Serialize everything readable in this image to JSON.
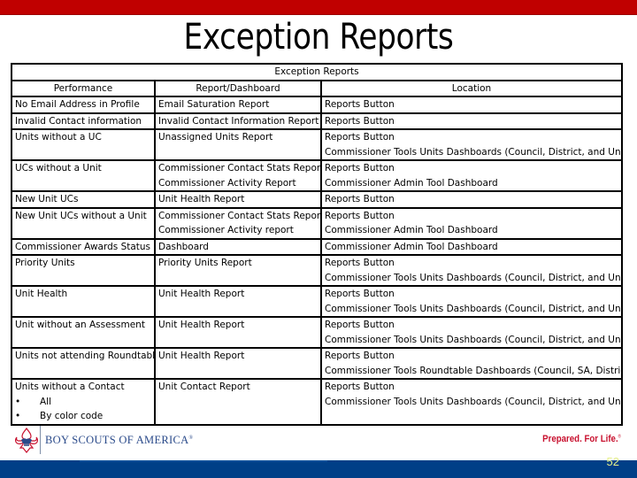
{
  "slide": {
    "title": "Exception Reports",
    "page_number": "52"
  },
  "colors": {
    "top_bar": "#c00000",
    "bottom_bar": "#003f87",
    "tagline": "#c8102e",
    "bsa_blue": "#2a4a8a",
    "page_number": "#e7f08a"
  },
  "table": {
    "caption": "Exception Reports",
    "headers": [
      "Performance",
      "Report/Dashboard",
      "Location"
    ],
    "rows": [
      {
        "performance": [
          "No Email Address in Profile"
        ],
        "report": [
          "Email Saturation Report"
        ],
        "location": [
          "Reports Button"
        ]
      },
      {
        "performance": [
          "Invalid Contact information"
        ],
        "report": [
          "Invalid Contact Information Report"
        ],
        "location": [
          "Reports Button"
        ]
      },
      {
        "performance": [
          "Units without a UC"
        ],
        "report": [
          "Unassigned Units Report"
        ],
        "location": [
          "Reports Button",
          "Commissioner Tools Units Dashboards (Council, District, and Unit)"
        ]
      },
      {
        "performance": [
          "UCs without a Unit"
        ],
        "report": [
          "Commissioner Contact Stats Report,",
          "Commissioner Activity Report"
        ],
        "location": [
          "Reports Button",
          "Commissioner Admin Tool Dashboard"
        ]
      },
      {
        "performance": [
          "New Unit UCs"
        ],
        "report": [
          "Unit Health Report"
        ],
        "location": [
          "Reports Button"
        ]
      },
      {
        "performance": [
          "New Unit UCs without a Unit"
        ],
        "report": [
          "Commissioner Contact Stats Report,",
          "Commissioner Activity report"
        ],
        "location": [
          "Reports Button",
          "Commissioner Admin Tool Dashboard"
        ]
      },
      {
        "performance": [
          "Commissioner Awards Status"
        ],
        "report": [
          "Dashboard"
        ],
        "location": [
          "Commissioner Admin Tool Dashboard"
        ]
      },
      {
        "performance": [
          "Priority Units"
        ],
        "report": [
          "Priority Units Report"
        ],
        "location": [
          "Reports Button",
          "Commissioner Tools Units Dashboards (Council, District, and Unit)"
        ]
      },
      {
        "performance": [
          "Unit Health"
        ],
        "report": [
          "Unit Health Report"
        ],
        "location": [
          "Reports Button",
          "Commissioner Tools Units Dashboards (Council, District, and Unit)"
        ]
      },
      {
        "performance": [
          "Unit without an Assessment"
        ],
        "report": [
          "Unit Health Report"
        ],
        "location": [
          "Reports Button",
          "Commissioner Tools Units Dashboards (Council, District, and Unit)"
        ]
      },
      {
        "performance": [
          "Units not attending Roundtable"
        ],
        "report": [
          "Unit Health Report"
        ],
        "location": [
          "Reports Button",
          "Commissioner Tools Roundtable Dashboards (Council, SA, District)"
        ]
      },
      {
        "performance": [
          "Units without a Contact"
        ],
        "performance_bullets": [
          "All",
          "By color code"
        ],
        "report": [
          "Unit Contact Report"
        ],
        "location": [
          "Reports Button",
          "Commissioner Tools Units Dashboards (Council, District, and Unit)"
        ]
      }
    ]
  },
  "footer": {
    "org_name": "BOY SCOUTS OF AMERICA",
    "org_mark": "®",
    "tagline": "Prepared. For Life.",
    "tagline_mark": "®",
    "bullet_glyph": "•",
    "logo_icon": "fleur-de-lis-emblem-icon"
  }
}
